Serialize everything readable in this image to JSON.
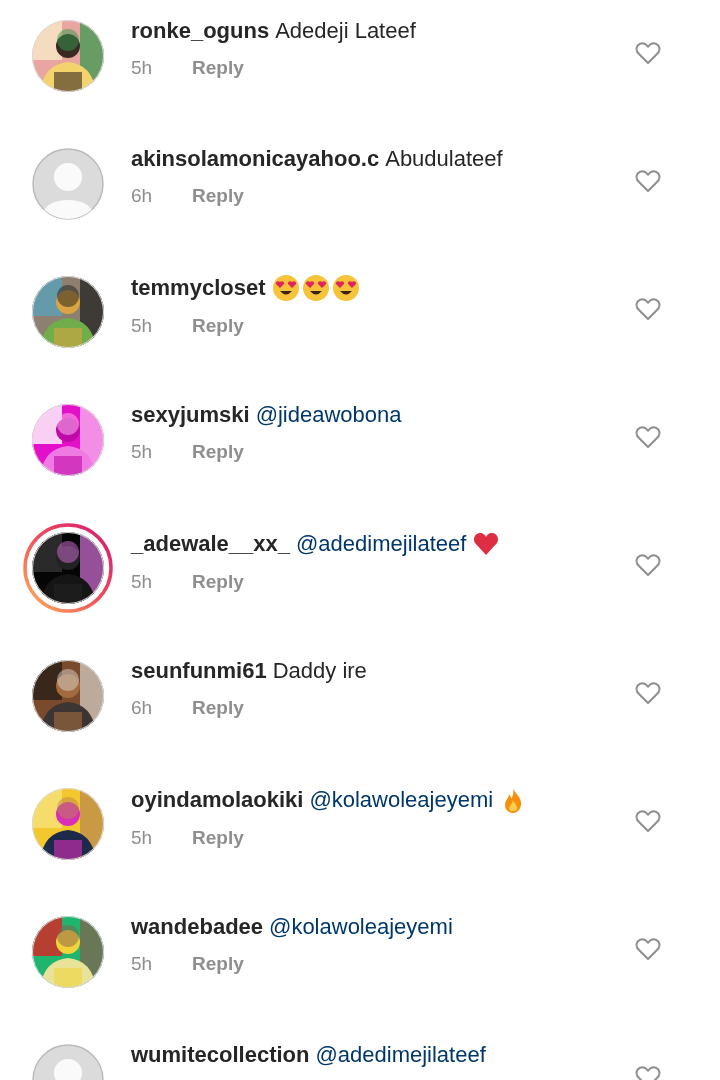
{
  "comments": [
    {
      "username": "ronke_oguns",
      "avatar": {
        "kind": "picture",
        "story_ring": false
      },
      "parts": [
        {
          "kind": "plain",
          "text": "Adedeji Lateef"
        }
      ],
      "time": "5h",
      "reply": "Reply",
      "liked": false
    },
    {
      "username": "akinsolamonicayahoo.c",
      "avatar": {
        "kind": "placeholder",
        "story_ring": false
      },
      "parts": [
        {
          "kind": "plain",
          "text": "Abudulateef"
        }
      ],
      "time": "6h",
      "reply": "Reply",
      "liked": false
    },
    {
      "username": "temmycloset",
      "avatar": {
        "kind": "picture",
        "story_ring": false
      },
      "parts": [
        {
          "kind": "heart-eyes-emoji"
        },
        {
          "kind": "heart-eyes-emoji"
        },
        {
          "kind": "heart-eyes-emoji"
        }
      ],
      "time": "5h",
      "reply": "Reply",
      "liked": false
    },
    {
      "username": "sexyjumski",
      "avatar": {
        "kind": "picture",
        "story_ring": false
      },
      "parts": [
        {
          "kind": "mention",
          "text": "@jideawobona"
        }
      ],
      "time": "5h",
      "reply": "Reply",
      "liked": false
    },
    {
      "username": "_adewale__xx_",
      "avatar": {
        "kind": "picture",
        "story_ring": true
      },
      "parts": [
        {
          "kind": "mention",
          "text": "@adedimejilateef"
        },
        {
          "kind": "red-heart-emoji"
        }
      ],
      "time": "5h",
      "reply": "Reply",
      "liked": false
    },
    {
      "username": "seunfunmi61",
      "avatar": {
        "kind": "picture",
        "story_ring": false
      },
      "parts": [
        {
          "kind": "plain",
          "text": "Daddy ire"
        }
      ],
      "time": "6h",
      "reply": "Reply",
      "liked": false
    },
    {
      "username": "oyindamolaokiki",
      "avatar": {
        "kind": "picture",
        "story_ring": false
      },
      "parts": [
        {
          "kind": "mention",
          "text": "@kolawoleajeyemi"
        },
        {
          "kind": "fire-emoji"
        }
      ],
      "time": "5h",
      "reply": "Reply",
      "liked": false
    },
    {
      "username": "wandebadee",
      "avatar": {
        "kind": "picture",
        "story_ring": false
      },
      "parts": [
        {
          "kind": "mention",
          "text": "@kolawoleajeyemi"
        }
      ],
      "time": "5h",
      "reply": "Reply",
      "liked": false
    },
    {
      "username": "wumitecollection",
      "avatar": {
        "kind": "placeholder",
        "story_ring": false
      },
      "parts": [
        {
          "kind": "mention",
          "text": "@adedimejilateef"
        }
      ],
      "liked": false
    }
  ]
}
